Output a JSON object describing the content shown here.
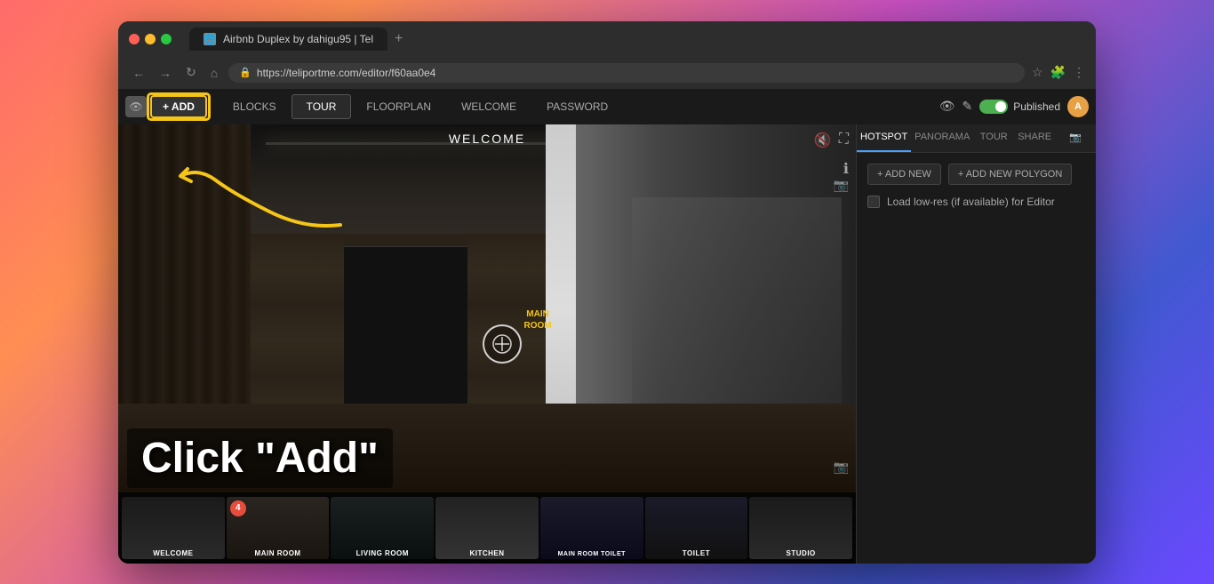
{
  "browser": {
    "title": "Airbnb Duplex by dahigu95 | Tel",
    "url": "https://teliportme.com/editor/f60aa0e4",
    "tab_plus": "+"
  },
  "app": {
    "add_label": "+ ADD",
    "nav_tabs": [
      {
        "id": "blocks",
        "label": "BLOCKS",
        "active": false
      },
      {
        "id": "tour",
        "label": "TOUR",
        "active": true
      },
      {
        "id": "floorplan",
        "label": "FLOORPLAN",
        "active": false
      },
      {
        "id": "welcome",
        "label": "WELCOME",
        "active": false
      },
      {
        "id": "password",
        "label": "PASSWORD",
        "active": false
      }
    ],
    "right_tabs": [
      {
        "id": "hotspot",
        "label": "HOTSPOT"
      },
      {
        "id": "panorama",
        "label": "PANORAMA"
      },
      {
        "id": "tour",
        "label": "TOUR"
      },
      {
        "id": "share",
        "label": "SHARE"
      }
    ],
    "published_label": "Published"
  },
  "panorama": {
    "welcome_label": "WELCOME",
    "main_room_label": "MAIN\nROOM",
    "main_room_toilet_label": "MAIN ROOM TOILET"
  },
  "side_panel": {
    "add_new_label": "+ ADD NEW",
    "add_polygon_label": "+ ADD NEW POLYGON",
    "load_low_res_label": "Load low-res (if available) for Editor"
  },
  "thumbnails": [
    {
      "id": "welcome",
      "label": "WELCOME",
      "has_badge": false
    },
    {
      "id": "main-room",
      "label": "MAIN ROOM",
      "has_badge": true,
      "badge": "4"
    },
    {
      "id": "living-room",
      "label": "LIVING ROOM",
      "has_badge": false
    },
    {
      "id": "kitchen",
      "label": "KITCHEN",
      "has_badge": false
    },
    {
      "id": "main-room-toilet",
      "label": "MAIN ROOM TOILET",
      "has_badge": false
    },
    {
      "id": "toilet",
      "label": "TOILET",
      "has_badge": false
    },
    {
      "id": "studio",
      "label": "STUDIO",
      "has_badge": false
    }
  ],
  "annotation": {
    "click_add_text": "Click \"Add\""
  },
  "colors": {
    "highlight_yellow": "#f5c518",
    "active_green": "#4caf50",
    "badge_red": "#e74c3c"
  }
}
